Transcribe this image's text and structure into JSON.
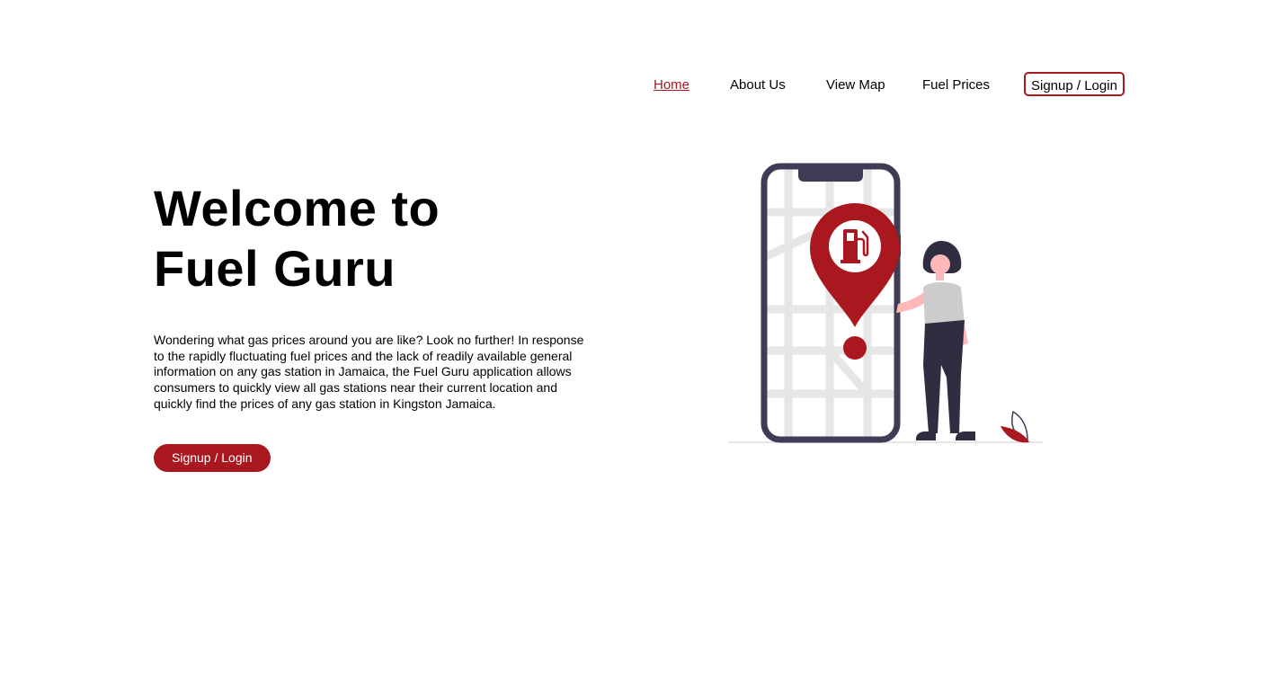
{
  "nav": {
    "home": "Home",
    "about": "About Us",
    "map": "View Map",
    "fuel": "Fuel Prices",
    "signup": "Signup / Login"
  },
  "hero": {
    "title_line1": "Welcome to",
    "title_line2": "Fuel Guru",
    "description": "Wondering what gas prices around you are like? Look no further! In response to the rapidly fluctuating fuel prices and the lack of readily available general information on any gas station in Jamaica, the Fuel Guru application allows consumers to quickly view all gas stations near their current location and quickly find the prices of any gas station in Kingston Jamaica.",
    "cta": "Signup / Login"
  },
  "colors": {
    "accent": "#a8181e",
    "phone_frame": "#3f3d56",
    "map_roads": "#e6e6e6",
    "skin": "#ffb8b8",
    "shirt": "#cccccc"
  },
  "icons": {
    "illustration": "phone-map-with-woman",
    "pin": "location-pin-icon",
    "pump": "fuel-pump-icon"
  }
}
